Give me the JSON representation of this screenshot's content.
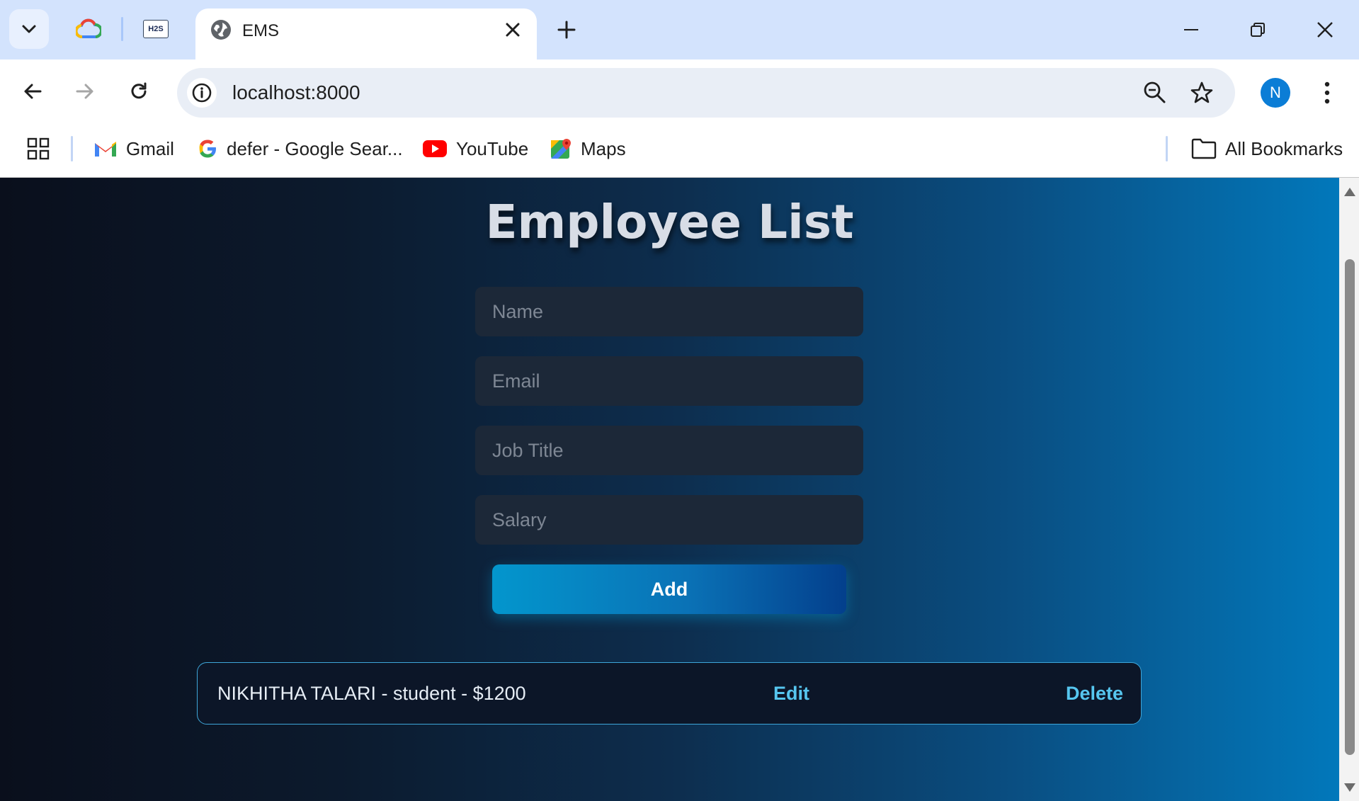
{
  "browser": {
    "active_tab": {
      "title": "EMS"
    },
    "pinned_tabs": [
      {
        "icon": "google-cloud-icon"
      },
      {
        "icon": "h2s-icon",
        "label": "H2S"
      }
    ],
    "url": "localhost:8000",
    "profile_initial": "N",
    "bookmarks": [
      {
        "label": "Gmail",
        "icon": "gmail-icon"
      },
      {
        "label": "defer - Google Sear...",
        "icon": "google-icon"
      },
      {
        "label": "YouTube",
        "icon": "youtube-icon"
      },
      {
        "label": "Maps",
        "icon": "maps-icon"
      }
    ],
    "all_bookmarks_label": "All Bookmarks"
  },
  "page": {
    "title": "Employee List",
    "form": {
      "name_placeholder": "Name",
      "email_placeholder": "Email",
      "job_title_placeholder": "Job Title",
      "salary_placeholder": "Salary",
      "add_label": "Add"
    },
    "employees": [
      {
        "summary": "NIKHITHA TALARI - student - $1200",
        "edit_label": "Edit",
        "delete_label": "Delete"
      }
    ]
  },
  "colors": {
    "accent": "#56c6ef",
    "tabstrip": "#d3e3fd"
  }
}
